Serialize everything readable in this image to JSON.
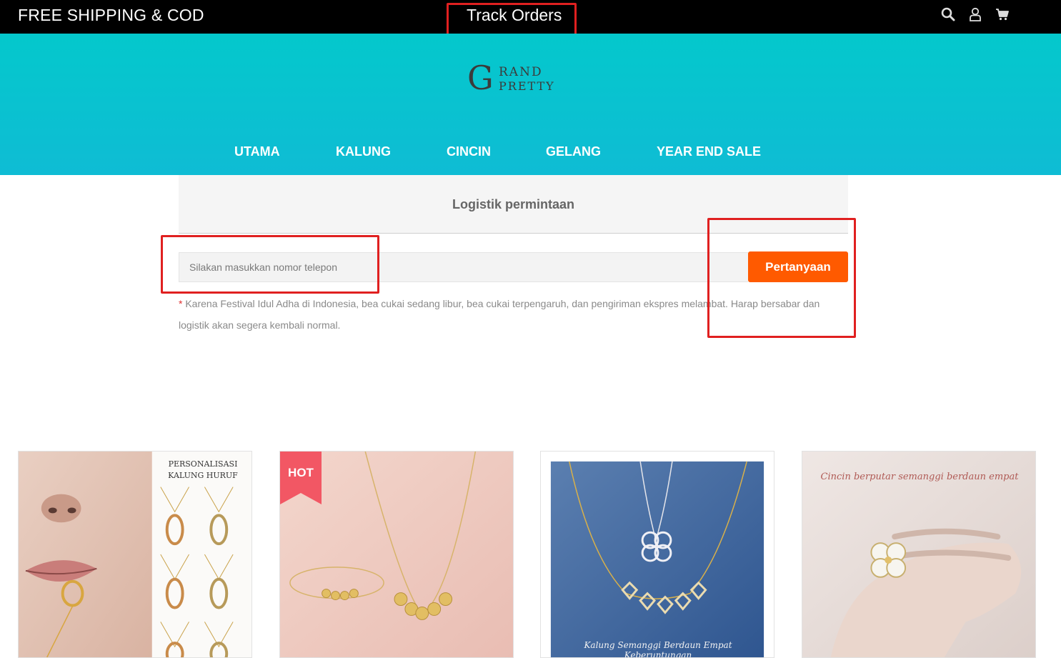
{
  "topbar": {
    "shipping_text": "FREE SHIPPING & COD",
    "track_orders": "Track Orders",
    "icons": [
      "search-icon",
      "user-icon",
      "cart-icon"
    ]
  },
  "brand": {
    "logo_letter": "G",
    "logo_line1": "RAND",
    "logo_line2": "PRETTY"
  },
  "nav": {
    "items": [
      "UTAMA",
      "KALUNG",
      "CINCIN",
      "GELANG",
      "YEAR END SALE"
    ]
  },
  "logistics": {
    "title": "Logistik permintaan",
    "phone_placeholder": "Silakan masukkan nomor telepon",
    "phone_value": "",
    "query_button": "Pertanyaan",
    "notice_star": "*",
    "notice_text": " Karena Festival Idul Adha di Indonesia, bea cukai sedang libur, bea cukai terpengaruh, dan pengiriman ekspres melambat. Harap bersabar dan logistik akan segera kembali normal."
  },
  "products": [
    {
      "heading_line1": "PERSONALISASI",
      "heading_line2": "KALUNG HURUF",
      "badge": ""
    },
    {
      "heading_line1": "",
      "heading_line2": "",
      "badge": "HOT"
    },
    {
      "heading_line1": "Kalung Semanggi Berdaun Empat Keberuntungan",
      "heading_line2": "",
      "badge": ""
    },
    {
      "heading_line1": "Cincin berputar semanggi berdaun empat",
      "heading_line2": "",
      "badge": ""
    }
  ],
  "colors": {
    "topbar_bg": "#000000",
    "header_teal": "#04c8cc",
    "accent_orange": "#ff5a00",
    "annotation_red": "#e02020"
  }
}
